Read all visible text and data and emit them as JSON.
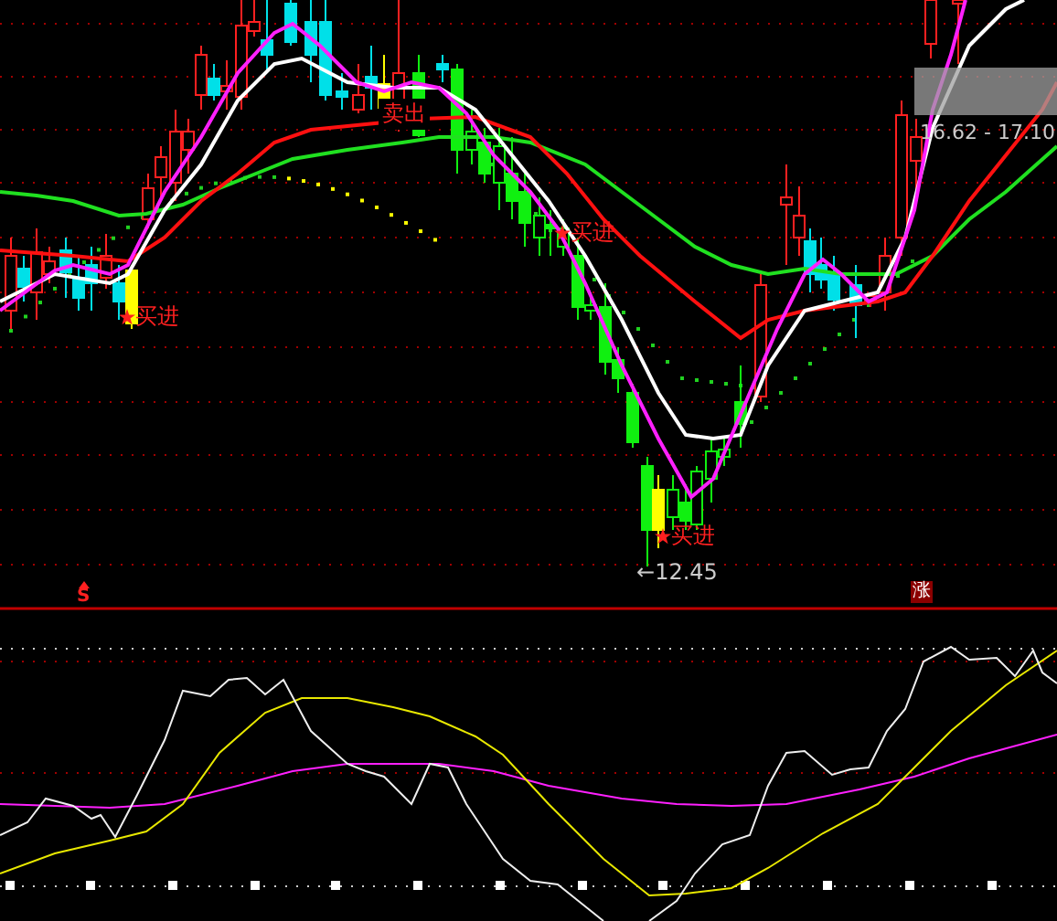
{
  "signals": [
    {
      "kind": "sell",
      "text": "卖出"
    },
    {
      "kind": "buy",
      "text": "买进"
    },
    {
      "kind": "buy",
      "text": "买进"
    },
    {
      "kind": "buy",
      "text": "买进"
    }
  ],
  "price_range": "16.62 - 17.10",
  "low_price": {
    "arrow": "←",
    "value": "12.45"
  },
  "markers": [
    {
      "kind": "s",
      "text": "S"
    },
    {
      "kind": "rise",
      "text": "涨"
    }
  ]
}
